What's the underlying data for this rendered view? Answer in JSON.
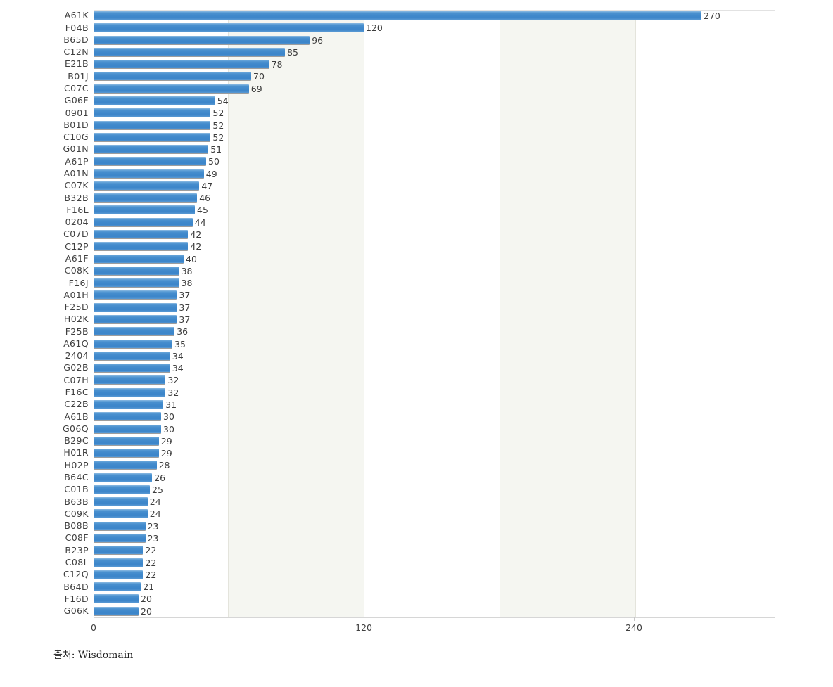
{
  "chart_data": {
    "type": "bar",
    "orientation": "horizontal",
    "title": "",
    "xlabel": "",
    "ylabel": "",
    "xlim": [
      0,
      303
    ],
    "xticks": [
      0,
      120,
      240
    ],
    "xtick_labels": [
      "0",
      "120",
      "240"
    ],
    "grid": true,
    "legend": false,
    "bar_color": "#3f88cb",
    "plot_background": "#ffffff",
    "band_color": "#f5f6f1",
    "categories": [
      "A61K",
      "F04B",
      "B65D",
      "C12N",
      "E21B",
      "B01J",
      "C07C",
      "G06F",
      "0901",
      "B01D",
      "C10G",
      "G01N",
      "A61P",
      "A01N",
      "C07K",
      "B32B",
      "F16L",
      "0204",
      "C07D",
      "C12P",
      "A61F",
      "C08K",
      "F16J",
      "A01H",
      "F25D",
      "H02K",
      "F25B",
      "A61Q",
      "2404",
      "G02B",
      "C07H",
      "F16C",
      "C22B",
      "A61B",
      "G06Q",
      "B29C",
      "H01R",
      "H02P",
      "B64C",
      "C01B",
      "B63B",
      "C09K",
      "B08B",
      "C08F",
      "B23P",
      "C08L",
      "C12Q",
      "B64D",
      "F16D",
      "G06K"
    ],
    "values": [
      270,
      120,
      96,
      85,
      78,
      70,
      69,
      54,
      52,
      52,
      52,
      51,
      50,
      49,
      47,
      46,
      45,
      44,
      42,
      42,
      40,
      38,
      38,
      37,
      37,
      37,
      36,
      35,
      34,
      34,
      32,
      32,
      31,
      30,
      30,
      29,
      29,
      28,
      26,
      25,
      24,
      24,
      23,
      23,
      22,
      22,
      22,
      21,
      20,
      20
    ],
    "value_labels": [
      "270",
      "120",
      "96",
      "85",
      "78",
      "70",
      "69",
      "54",
      "52",
      "52",
      "52",
      "51",
      "50",
      "49",
      "47",
      "46",
      "45",
      "44",
      "42",
      "42",
      "40",
      "38",
      "38",
      "37",
      "37",
      "37",
      "36",
      "35",
      "34",
      "34",
      "32",
      "32",
      "31",
      "30",
      "30",
      "29",
      "29",
      "28",
      "26",
      "25",
      "24",
      "24",
      "23",
      "23",
      "22",
      "22",
      "22",
      "21",
      "20",
      "20"
    ]
  },
  "footer": {
    "source_text": "출처: Wisdomain"
  }
}
